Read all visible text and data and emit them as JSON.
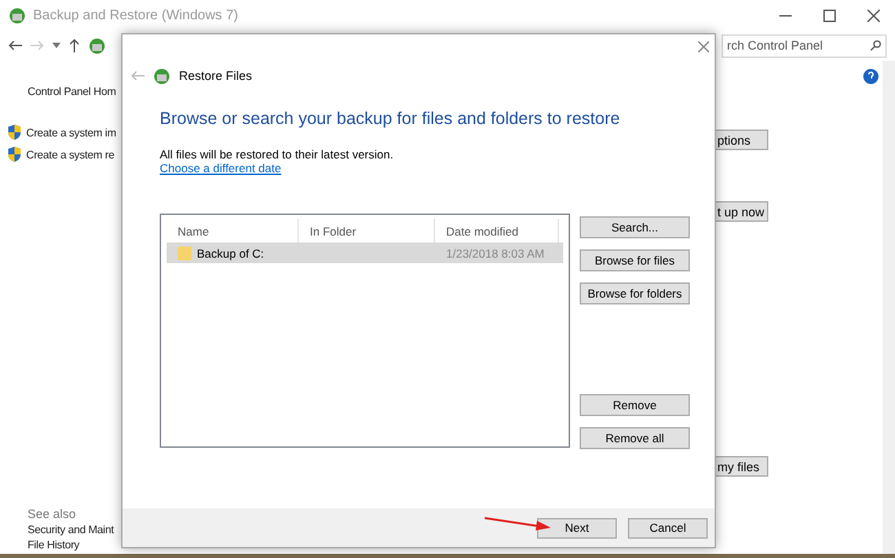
{
  "window": {
    "title": "Backup and Restore (Windows 7)",
    "search_placeholder": "rch Control Panel"
  },
  "sidebar": {
    "items": [
      {
        "label": "Control Panel Hom",
        "kind": "link"
      },
      {
        "label": "Create a system im",
        "kind": "shield"
      },
      {
        "label": "Create a system re",
        "kind": "shield"
      }
    ],
    "see_also_heading": "See also",
    "see_also": [
      "Security and Maint",
      "File History"
    ]
  },
  "right_buttons": [
    "ptions",
    "t up now",
    "my files"
  ],
  "dialog": {
    "title": "Restore Files",
    "heading": "Browse or search your backup for files and folders to restore",
    "note": "All files will be restored to their latest version.",
    "link": "Choose a different date",
    "columns": [
      "Name",
      "In Folder",
      "Date modified"
    ],
    "rows": [
      {
        "name": "Backup of C:",
        "date": "1/23/2018 8:03 AM",
        "selected": true
      }
    ],
    "top_buttons": [
      "Search...",
      "Browse for files",
      "Browse for folders"
    ],
    "bottom_buttons": [
      "Remove",
      "Remove all"
    ],
    "footer_buttons": [
      "Next",
      "Cancel"
    ]
  }
}
